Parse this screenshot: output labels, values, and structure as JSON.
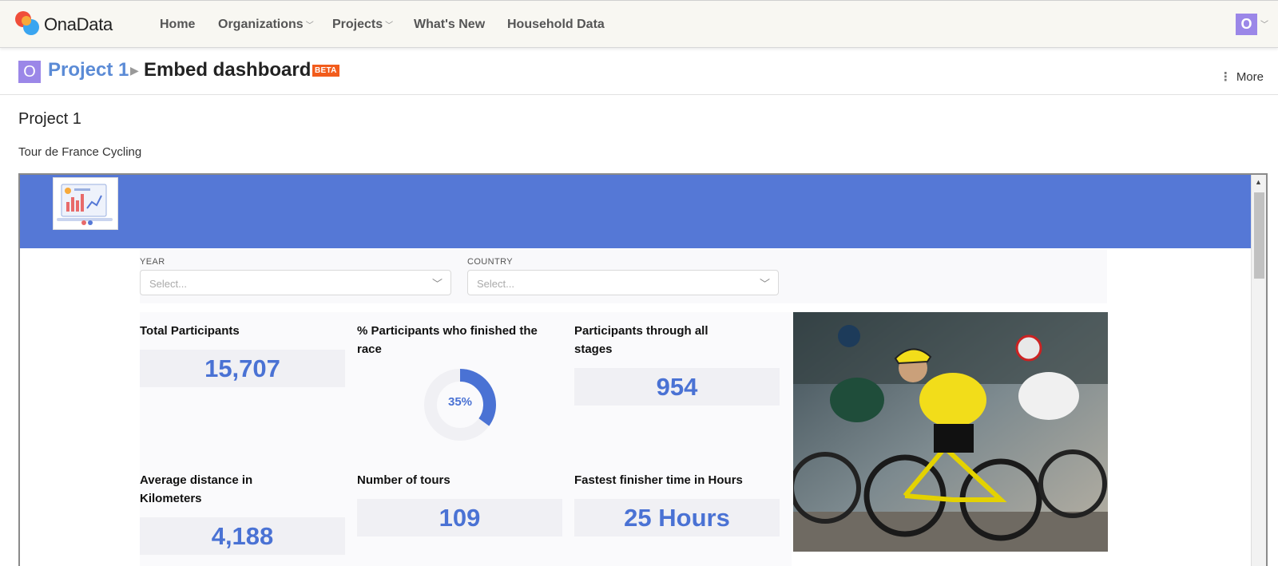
{
  "app": {
    "brand": "OnaData"
  },
  "nav": {
    "items": [
      {
        "label": "Home",
        "has_menu": false
      },
      {
        "label": "Organizations",
        "has_menu": true
      },
      {
        "label": "Projects",
        "has_menu": true
      },
      {
        "label": "What's New",
        "has_menu": false
      },
      {
        "label": "Household Data",
        "has_menu": false
      }
    ],
    "user_initial": "O"
  },
  "header": {
    "project_initial": "O",
    "project": "Project 1",
    "separator": "▶",
    "page": "Embed dashboard",
    "badge": "BETA",
    "more_label": "More"
  },
  "section": {
    "title": "Project 1",
    "subtitle": "Tour de France Cycling"
  },
  "dashboard": {
    "colors": {
      "banner": "#5578d6",
      "accent": "#4a72d4"
    },
    "filters": [
      {
        "label": "YEAR",
        "placeholder": "Select..."
      },
      {
        "label": "COUNTRY",
        "placeholder": "Select..."
      }
    ],
    "cards": {
      "total_participants": {
        "title": "Total Participants",
        "value": "15,707"
      },
      "pct_finished": {
        "title": "% Participants who finished the race",
        "value": "35%",
        "fraction": 0.35
      },
      "all_stages": {
        "title": "Participants through all stages",
        "value": "954"
      },
      "avg_distance": {
        "title": "Average distance in Kilometers",
        "value": "4,188"
      },
      "num_tours": {
        "title": "Number of tours",
        "value": "109"
      },
      "fastest_time": {
        "title": "Fastest finisher time in Hours",
        "value": "25 Hours"
      }
    }
  }
}
